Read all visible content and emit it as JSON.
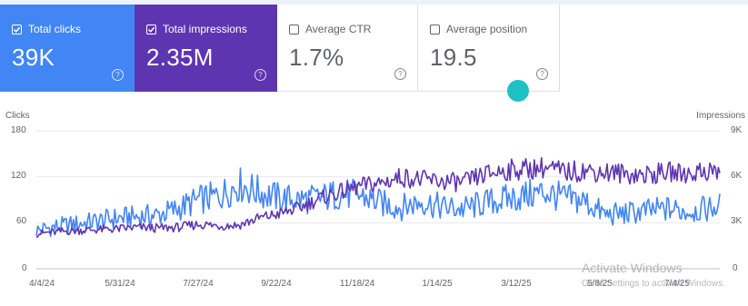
{
  "cards": {
    "clicks": {
      "label": "Total clicks",
      "value": "39K",
      "checked": true,
      "color": "#4285f4"
    },
    "impressions": {
      "label": "Total impressions",
      "value": "2.35M",
      "checked": true,
      "color": "#5e35b1"
    },
    "ctr": {
      "label": "Average CTR",
      "value": "1.7%",
      "checked": false
    },
    "position": {
      "label": "Average position",
      "value": "19.5",
      "checked": false
    }
  },
  "help_glyph": "?",
  "chart_data": {
    "type": "line",
    "left_axis_title": "Clicks",
    "right_axis_title": "Impressions",
    "left_ticks": [
      "180",
      "120",
      "60",
      "0"
    ],
    "right_ticks": [
      "9K",
      "6K",
      "3K",
      "0"
    ],
    "ylim_left": [
      0,
      180
    ],
    "ylim_right": [
      0,
      9000
    ],
    "x_tick_labels": [
      "4/4/24",
      "5/31/24",
      "7/27/24",
      "9/22/24",
      "11/18/24",
      "1/14/25",
      "3/12/25",
      "5/8/25",
      "7/4/25"
    ],
    "grid": true,
    "series": [
      {
        "name": "Clicks",
        "axis": "left",
        "color": "#4285f4",
        "points": [
          [
            "4/4/24",
            50
          ],
          [
            "4/18/24",
            55
          ],
          [
            "5/2/24",
            58
          ],
          [
            "5/16/24",
            62
          ],
          [
            "5/31/24",
            66
          ],
          [
            "6/14/24",
            68
          ],
          [
            "6/28/24",
            70
          ],
          [
            "7/12/24",
            78
          ],
          [
            "7/27/24",
            90
          ],
          [
            "8/10/24",
            95
          ],
          [
            "8/24/24",
            110
          ],
          [
            "9/7/24",
            100
          ],
          [
            "9/22/24",
            92
          ],
          [
            "10/6/24",
            90
          ],
          [
            "10/20/24",
            92
          ],
          [
            "11/3/24",
            98
          ],
          [
            "11/18/24",
            95
          ],
          [
            "12/2/24",
            85
          ],
          [
            "12/16/24",
            80
          ],
          [
            "12/30/24",
            88
          ],
          [
            "1/14/25",
            80
          ],
          [
            "1/28/25",
            78
          ],
          [
            "2/11/25",
            85
          ],
          [
            "2/25/25",
            90
          ],
          [
            "3/12/25",
            95
          ],
          [
            "3/26/25",
            100
          ],
          [
            "4/9/25",
            92
          ],
          [
            "4/23/25",
            88
          ],
          [
            "5/8/25",
            70
          ],
          [
            "5/22/25",
            72
          ],
          [
            "6/5/25",
            75
          ],
          [
            "6/20/25",
            78
          ],
          [
            "7/4/25",
            75
          ],
          [
            "7/18/25",
            78
          ],
          [
            "7/27/25",
            82
          ]
        ]
      },
      {
        "name": "Impressions",
        "axis": "right",
        "color": "#5e35b1",
        "points": [
          [
            "4/4/24",
            2300
          ],
          [
            "4/18/24",
            2400
          ],
          [
            "5/2/24",
            2500
          ],
          [
            "5/16/24",
            2550
          ],
          [
            "5/31/24",
            2600
          ],
          [
            "6/14/24",
            2700
          ],
          [
            "6/28/24",
            2650
          ],
          [
            "7/12/24",
            2700
          ],
          [
            "7/27/24",
            2900
          ],
          [
            "8/10/24",
            2800
          ],
          [
            "8/24/24",
            2850
          ],
          [
            "9/7/24",
            3300
          ],
          [
            "9/22/24",
            3600
          ],
          [
            "10/6/24",
            4000
          ],
          [
            "10/20/24",
            4600
          ],
          [
            "11/3/24",
            5000
          ],
          [
            "11/18/24",
            5400
          ],
          [
            "12/2/24",
            5600
          ],
          [
            "12/16/24",
            6000
          ],
          [
            "12/30/24",
            5800
          ],
          [
            "1/14/25",
            5700
          ],
          [
            "1/28/25",
            5600
          ],
          [
            "2/11/25",
            6100
          ],
          [
            "2/25/25",
            6400
          ],
          [
            "3/12/25",
            6500
          ],
          [
            "3/26/25",
            6600
          ],
          [
            "4/9/25",
            6300
          ],
          [
            "4/23/25",
            6400
          ],
          [
            "5/8/25",
            6300
          ],
          [
            "5/22/25",
            6200
          ],
          [
            "6/5/25",
            6100
          ],
          [
            "6/20/25",
            6300
          ],
          [
            "7/4/25",
            6200
          ],
          [
            "7/18/25",
            6400
          ],
          [
            "7/27/25",
            6300
          ]
        ]
      }
    ]
  },
  "watermark": {
    "title": "Activate Windows",
    "subtitle": "Go to Settings to activate Windows."
  }
}
